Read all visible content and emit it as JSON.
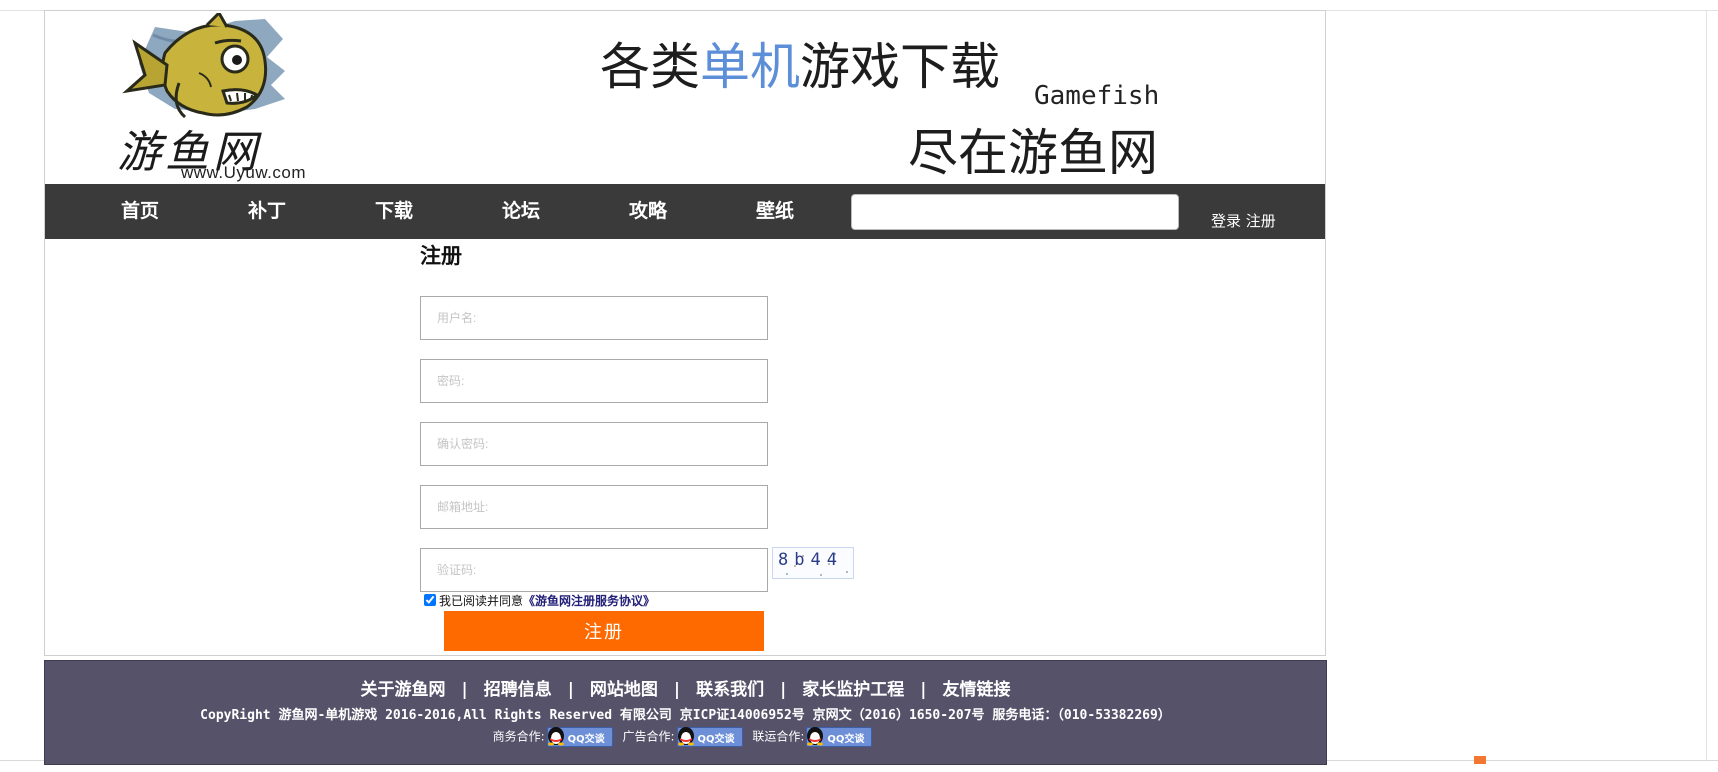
{
  "header": {
    "logo": {
      "name_cn": "游鱼网",
      "url_text": "www.Uyuw.com"
    },
    "slogan": {
      "line1_before": "各类",
      "line1_highlight": "单机",
      "line1_after": "游戏下载",
      "en": "Gamefish",
      "line2": "尽在游鱼网"
    },
    "colors": {
      "highlight": "#5d8ed8"
    }
  },
  "nav": {
    "items": [
      {
        "label": "首页"
      },
      {
        "label": "补丁"
      },
      {
        "label": "下载"
      },
      {
        "label": "论坛"
      },
      {
        "label": "攻略"
      },
      {
        "label": "壁纸"
      }
    ],
    "search_value": "",
    "login": "登录",
    "register": "注册",
    "colors": {
      "bar": "#3a3a3a"
    }
  },
  "form": {
    "title": "注册",
    "fields": {
      "username": {
        "placeholder": "用户名:"
      },
      "password": {
        "placeholder": "密码:"
      },
      "confirm_password": {
        "placeholder": "确认密码:"
      },
      "email": {
        "placeholder": "邮箱地址:"
      },
      "captcha": {
        "placeholder": "验证码:"
      }
    },
    "captcha_image_text": "8b44",
    "agree": {
      "checked": true,
      "text": "我已阅读并同意",
      "link": "《游鱼网注册服务协议》"
    },
    "submit": "注册",
    "colors": {
      "submit_bg": "#ff6a00"
    }
  },
  "footer": {
    "links": [
      "关于游鱼网",
      "招聘信息",
      "网站地图",
      "联系我们",
      "家长监护工程",
      "友情链接"
    ],
    "separator": "|",
    "copyright": "CopyRight 游鱼网-单机游戏 2016-2016,All Rights Reserved 有限公司 京ICP证14006952号 京网文（2016）1650-207号 服务电话：（010-53382269）",
    "cooperation": [
      {
        "label": "商务合作:",
        "badge": "QQ交谈"
      },
      {
        "label": "广告合作:",
        "badge": "QQ交谈"
      },
      {
        "label": "联运合作:",
        "badge": "QQ交谈"
      }
    ],
    "colors": {
      "bg": "#565269"
    }
  }
}
